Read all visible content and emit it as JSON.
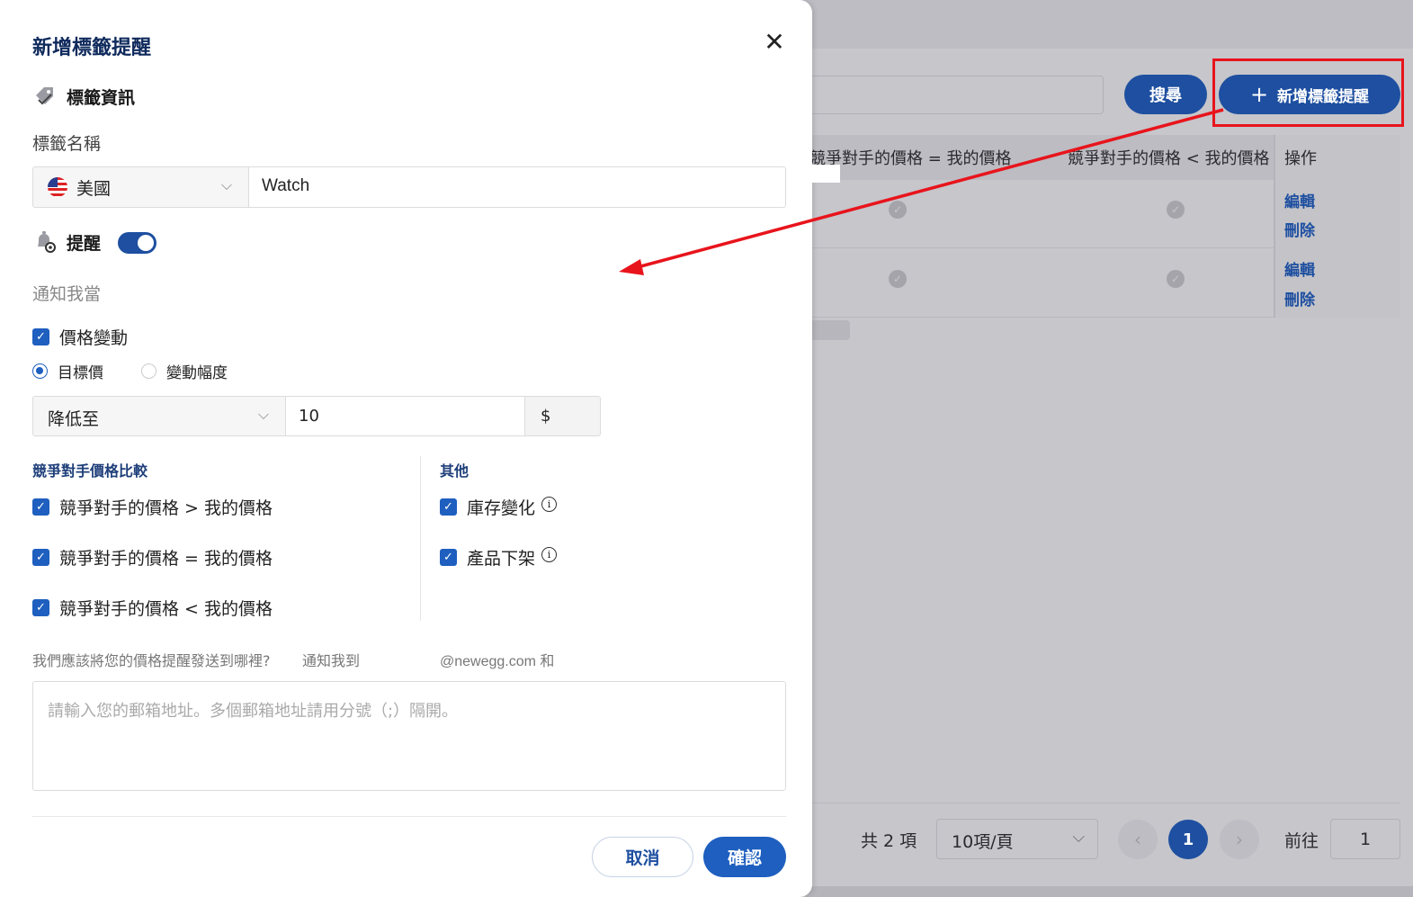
{
  "background": {
    "search_button": "搜尋",
    "add_button": "新增標籤提醒",
    "add_button_icon": "plus-icon",
    "table": {
      "headers": [
        "競爭對手的價格 = 我的價格",
        "競爭對手的價格 < 我的價格",
        "操作"
      ],
      "rows": [
        {
          "edit": "編輯",
          "delete": "刪除"
        },
        {
          "edit": "編輯",
          "delete": "刪除"
        }
      ]
    },
    "pagination": {
      "total": "共 2 項",
      "page_size": "10項/頁",
      "current_page": "1",
      "goto_label": "前往",
      "goto_value": "1"
    },
    "highlight_color": "#e8141c"
  },
  "drawer": {
    "title": "新增標籤提醒",
    "tag_section": {
      "title": "標籤資訊",
      "icon": "tag-icon",
      "name_label": "標籤名稱",
      "country": "美國",
      "country_icon": "us-flag-icon",
      "name_value": "Watch"
    },
    "remind_section": {
      "title": "提醒",
      "icon": "bell-gear-icon",
      "enabled": true,
      "notify_label": "通知我當",
      "price_change": "價格變動",
      "radio_target": "目標價",
      "radio_range": "變動幅度",
      "direction": "降低至",
      "value": "10",
      "currency": "$"
    },
    "competitor": {
      "title": "競爭對手價格比較",
      "options": [
        "競爭對手的價格 > 我的價格",
        "競爭對手的價格 = 我的價格",
        "競爭對手的價格 < 我的價格"
      ]
    },
    "other": {
      "title": "其他",
      "options": [
        "庫存變化",
        "產品下架"
      ]
    },
    "email": {
      "question": "我們應該將您的價格提醒發送到哪裡?",
      "notify_to": "通知我到",
      "domain": "@newegg.com 和",
      "placeholder": "請輸入您的郵箱地址。多個郵箱地址請用分號（;）隔開。"
    },
    "cancel": "取消",
    "confirm": "確認"
  },
  "colors": {
    "primary": "#1e4fa0",
    "checkbox": "#1e5fbf",
    "title": "#0f2a5c"
  }
}
